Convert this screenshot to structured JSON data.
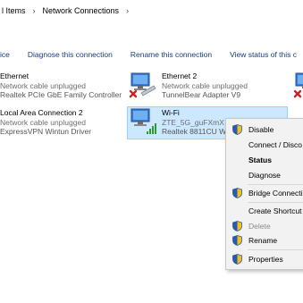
{
  "breadcrumb": {
    "items": [
      "l Items",
      "Network Connections"
    ],
    "separator": "›"
  },
  "toolbar": {
    "items": [
      "ice",
      "Diagnose this connection",
      "Rename this connection",
      "View status of this c"
    ]
  },
  "connections": [
    {
      "name": "Ethernet",
      "status": "Network cable unplugged",
      "device": "Realtek PCIe GbE Family Controller"
    },
    {
      "name": "Ethernet 2",
      "status": "Network cable unplugged",
      "device": "TunnelBear Adapter V9"
    },
    {
      "name": "Local Area Connection 2",
      "status": "Network cable unplugged",
      "device": "ExpressVPN Wintun Driver"
    },
    {
      "name": "Wi-Fi",
      "status": "ZTE_5G_guFXmX",
      "device": "Realtek 8811CU W"
    }
  ],
  "context_menu": {
    "disable": "Disable",
    "connect": "Connect / Disco",
    "status": "Status",
    "diagnose": "Diagnose",
    "bridge": "Bridge Connecti",
    "shortcut": "Create Shortcut",
    "delete": "Delete",
    "rename": "Rename",
    "properties": "Properties"
  },
  "colors": {
    "toolbar_link": "#1a3a7a",
    "selection_bg": "#cce8ff",
    "selection_border": "#99d1ff",
    "menu_bg": "#f2f2f2",
    "error_red": "#d32020",
    "signal_green": "#2e9a2e"
  }
}
